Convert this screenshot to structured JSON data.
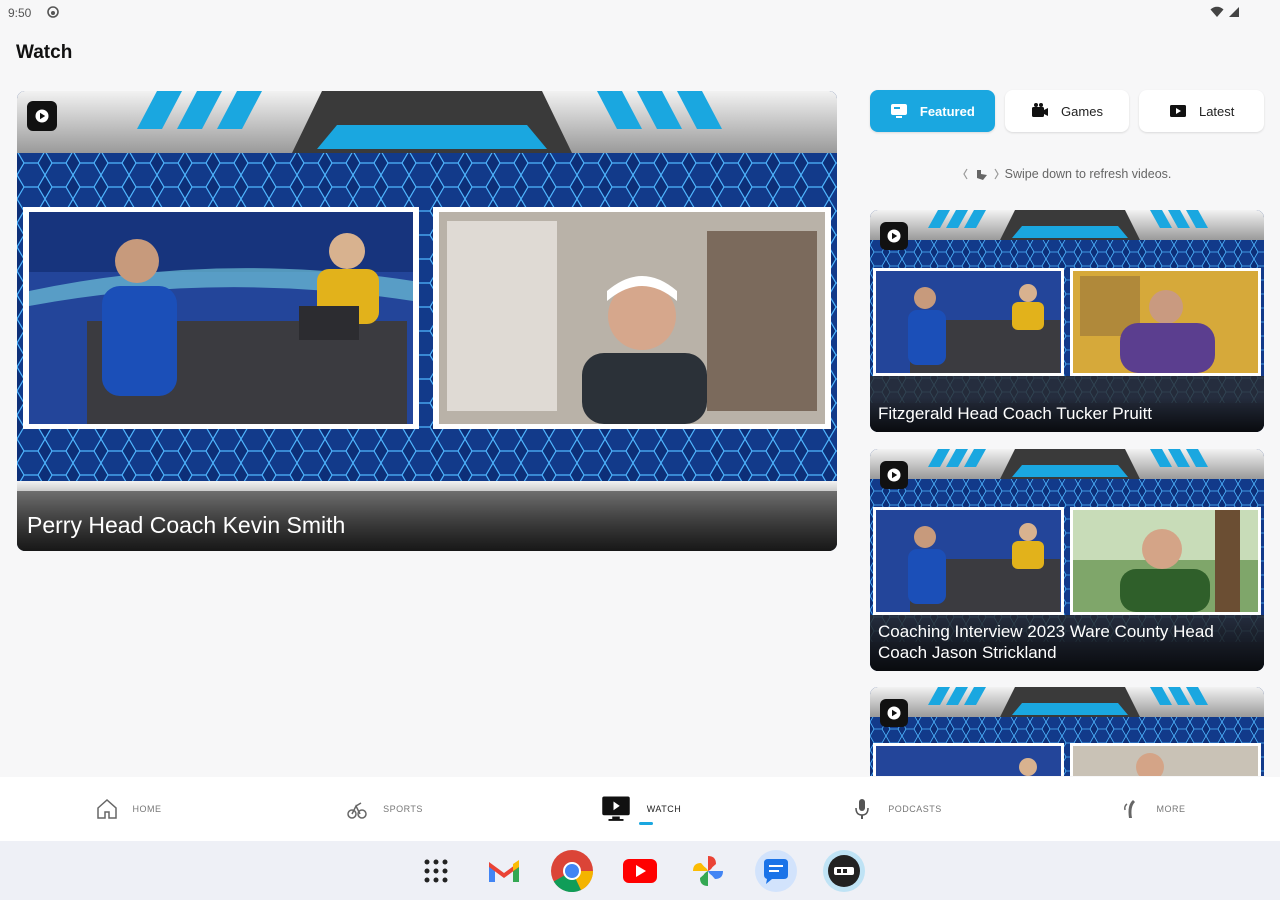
{
  "status_bar": {
    "time": "9:50"
  },
  "page": {
    "title": "Watch"
  },
  "hero": {
    "title": "Perry Head Coach Kevin Smith"
  },
  "tabs": [
    {
      "label": "Featured",
      "icon": "tv-icon",
      "active": true
    },
    {
      "label": "Games",
      "icon": "camera-icon",
      "active": false
    },
    {
      "label": "Latest",
      "icon": "video-icon",
      "active": false
    }
  ],
  "hint": {
    "text": "Swipe down to refresh videos."
  },
  "videos": [
    {
      "title": "Fitzgerald Head Coach Tucker Pruitt"
    },
    {
      "title": "Coaching Interview 2023 Ware County Head Coach Jason Strickland"
    },
    {
      "title": ""
    }
  ],
  "bottom_nav": [
    {
      "label": "HOME",
      "icon": "home-icon",
      "active": false
    },
    {
      "label": "SPORTS",
      "icon": "sports-icon",
      "active": false
    },
    {
      "label": "WATCH",
      "icon": "watch-icon",
      "active": true
    },
    {
      "label": "PODCASTS",
      "icon": "microphone-icon",
      "active": false
    },
    {
      "label": "MORE",
      "icon": "more-icon",
      "active": false
    }
  ],
  "dock": [
    "app-drawer-icon",
    "gmail-icon",
    "chrome-icon",
    "youtube-icon",
    "photos-icon",
    "messages-icon",
    "gpb-icon"
  ],
  "colors": {
    "accent": "#1aa7e0",
    "background": "#f7f7f8",
    "thumbnail_blue": "#0f2d6b"
  }
}
